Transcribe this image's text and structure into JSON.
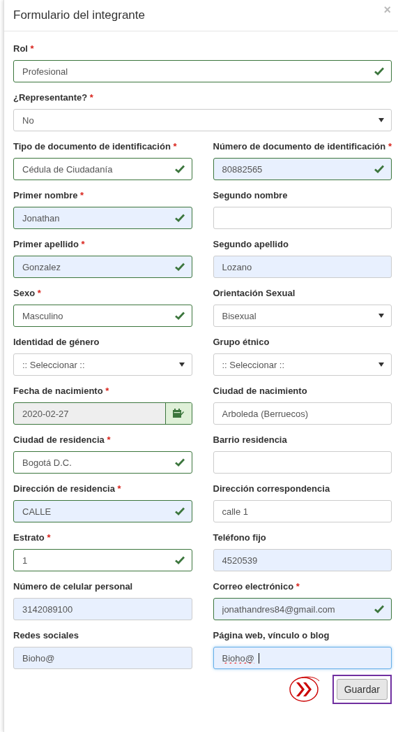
{
  "modal": {
    "title": "Formulario del integrante",
    "close": "×"
  },
  "rows": [
    {
      "fields": [
        {
          "label": "Rol",
          "required_mark": "*",
          "kind": "text",
          "value": "Profesional",
          "valid": true,
          "autofilled": false,
          "focused": false,
          "misspelled": false
        }
      ]
    },
    {
      "fields": [
        {
          "label": "¿Representante?",
          "required_mark": "*",
          "kind": "select",
          "value": "No",
          "valid": false,
          "autofilled": false,
          "focused": false,
          "misspelled": false
        }
      ]
    },
    {
      "fields": [
        {
          "label": "Tipo de documento de identificación",
          "required_mark": "*",
          "kind": "select",
          "value": "Cédula de Ciudadanía",
          "valid": true,
          "autofilled": false,
          "focused": false,
          "misspelled": false
        },
        {
          "label": "Número de documento de identificación",
          "required_mark": "*",
          "kind": "text",
          "value": "80882565",
          "valid": true,
          "autofilled": true,
          "focused": false,
          "misspelled": false
        }
      ]
    },
    {
      "fields": [
        {
          "label": "Primer nombre",
          "required_mark": "*",
          "kind": "text",
          "value": "Jonathan",
          "valid": true,
          "autofilled": true,
          "focused": false,
          "misspelled": false
        },
        {
          "label": "Segundo nombre",
          "kind": "text",
          "valid": false,
          "autofilled": false,
          "focused": false
        }
      ]
    },
    {
      "fields": [
        {
          "label": "Primer apellido",
          "required_mark": "*",
          "kind": "text",
          "value": "Gonzalez",
          "valid": true,
          "autofilled": true,
          "focused": false,
          "misspelled": false
        },
        {
          "label": "Segundo apellido",
          "kind": "text",
          "value": "Lozano",
          "valid": false,
          "autofilled": true,
          "focused": false,
          "misspelled": false
        }
      ]
    },
    {
      "fields": [
        {
          "label": "Sexo",
          "required_mark": "*",
          "kind": "select",
          "value": "Masculino",
          "valid": true,
          "autofilled": false,
          "focused": false,
          "misspelled": false
        },
        {
          "label": "Orientación Sexual",
          "kind": "select",
          "value": "Bisexual",
          "valid": false,
          "autofilled": false,
          "focused": false,
          "misspelled": false
        }
      ]
    },
    {
      "fields": [
        {
          "label": "Identidad de género",
          "kind": "select",
          "value": ":: Seleccionar ::",
          "valid": false,
          "autofilled": false,
          "focused": false,
          "misspelled": false
        },
        {
          "label": "Grupo étnico",
          "kind": "select",
          "value": ":: Seleccionar ::",
          "valid": false,
          "autofilled": false,
          "focused": false,
          "misspelled": false
        }
      ]
    },
    {
      "fields": [
        {
          "label": "Fecha de nacimiento",
          "required_mark": "*",
          "kind": "date",
          "value": "2020-02-27",
          "valid": true,
          "autofilled": false,
          "focused": false,
          "misspelled": false
        },
        {
          "label": "Ciudad de nacimiento",
          "kind": "text",
          "value": "Arboleda (Berruecos)",
          "valid": false,
          "autofilled": false,
          "focused": false,
          "misspelled": false
        }
      ]
    },
    {
      "fields": [
        {
          "label": "Ciudad de residencia",
          "required_mark": "*",
          "kind": "text",
          "value": "Bogotá D.C.",
          "valid": true,
          "autofilled": false,
          "focused": false,
          "misspelled": false
        },
        {
          "label": "Barrio residencia",
          "kind": "text",
          "valid": false,
          "autofilled": false,
          "focused": false
        }
      ]
    },
    {
      "fields": [
        {
          "label": "Dirección de residencia",
          "required_mark": "*",
          "kind": "text",
          "value": "CALLE",
          "valid": true,
          "autofilled": true,
          "focused": false,
          "misspelled": false
        },
        {
          "label": "Dirección correspondencia",
          "kind": "text",
          "value": "calle 1",
          "valid": false,
          "autofilled": false,
          "focused": false,
          "misspelled": false
        }
      ]
    },
    {
      "fields": [
        {
          "label": "Estrato",
          "required_mark": "*",
          "kind": "select",
          "value": "1",
          "valid": true,
          "autofilled": false,
          "focused": false,
          "misspelled": false
        },
        {
          "label": "Teléfono fijo",
          "kind": "text",
          "value": "4520539",
          "valid": false,
          "autofilled": true,
          "focused": false,
          "misspelled": false
        }
      ]
    },
    {
      "fields": [
        {
          "label": "Número de celular personal",
          "kind": "text",
          "value": "3142089100",
          "valid": false,
          "autofilled": true,
          "focused": false,
          "misspelled": false
        },
        {
          "label": "Correo electrónico",
          "required_mark": "*",
          "kind": "text",
          "value": "jonathandres84@gmail.com",
          "valid": true,
          "autofilled": true,
          "focused": false,
          "misspelled": false
        }
      ]
    },
    {
      "fields": [
        {
          "label": "Redes sociales",
          "kind": "text",
          "value": "Bioho@",
          "valid": false,
          "autofilled": true,
          "focused": false,
          "misspelled": false
        },
        {
          "label": "Página web, vínculo o blog",
          "kind": "text",
          "value": "Bioho@",
          "valid": false,
          "autofilled": true,
          "focused": true,
          "misspelled": true
        }
      ]
    }
  ],
  "footer": {
    "save_button": {
      "label": "Guardar",
      "highlighted": true
    }
  }
}
